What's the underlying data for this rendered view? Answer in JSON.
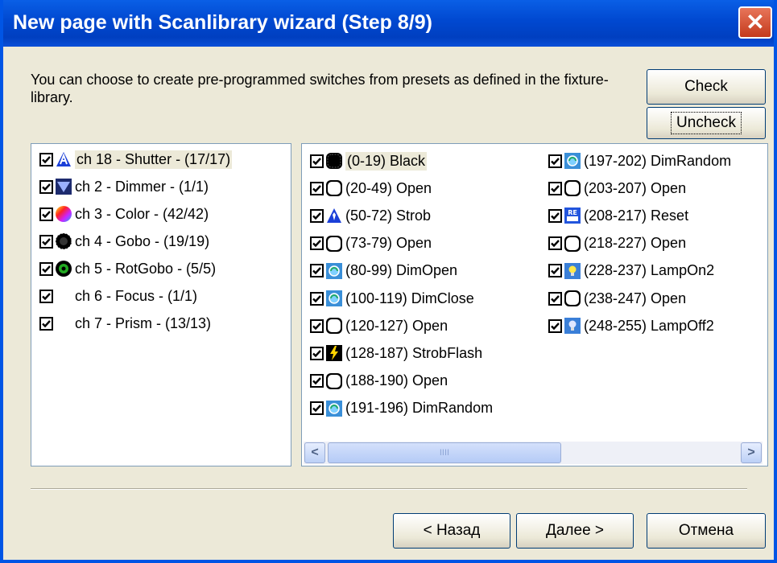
{
  "window": {
    "title": "New page with Scanlibrary wizard (Step 8/9)",
    "close_glyph": "✕"
  },
  "description": "You can choose to create pre-programmed switches from presets as defined in the fixture-library.",
  "buttons": {
    "check": "Check",
    "uncheck": "Uncheck",
    "back": "< Назад",
    "next": "Далее >",
    "cancel": "Отмена"
  },
  "channels": [
    {
      "label": "ch 18 - Shutter - (17/17)",
      "icon": "shutter-icon",
      "checked": true,
      "selected": true
    },
    {
      "label": "ch 2 - Dimmer - (1/1)",
      "icon": "dimmer-icon",
      "checked": true
    },
    {
      "label": "ch 3 - Color - (42/42)",
      "icon": "color-icon",
      "checked": true
    },
    {
      "label": "ch 4 - Gobo - (19/19)",
      "icon": "gobo-icon",
      "checked": true
    },
    {
      "label": "ch 5 - RotGobo - (5/5)",
      "icon": "rotgobo-icon",
      "checked": true
    },
    {
      "label": "ch 6 - Focus - (1/1)",
      "icon": "",
      "checked": true
    },
    {
      "label": "ch 7 - Prism - (13/13)",
      "icon": "",
      "checked": true
    }
  ],
  "presets_col1": [
    {
      "label": "(0-19) Black",
      "icon": "black-icon",
      "checked": true,
      "selected": true
    },
    {
      "label": "(20-49) Open",
      "icon": "open-icon",
      "checked": true
    },
    {
      "label": "(50-72) Strob",
      "icon": "strob-icon",
      "checked": true
    },
    {
      "label": "(73-79) Open",
      "icon": "open-icon",
      "checked": true
    },
    {
      "label": "(80-99) DimOpen",
      "icon": "dim-icon",
      "checked": true
    },
    {
      "label": "(100-119) DimClose",
      "icon": "dim-icon",
      "checked": true
    },
    {
      "label": "(120-127) Open",
      "icon": "open-icon",
      "checked": true
    },
    {
      "label": "(128-187) StrobFlash",
      "icon": "flash-icon",
      "checked": true
    },
    {
      "label": "(188-190) Open",
      "icon": "open-icon",
      "checked": true
    },
    {
      "label": "(191-196) DimRandom",
      "icon": "dim-icon",
      "checked": true
    }
  ],
  "presets_col2": [
    {
      "label": "(197-202) DimRandom",
      "icon": "dim-icon",
      "checked": true
    },
    {
      "label": "(203-207) Open",
      "icon": "open-icon",
      "checked": true
    },
    {
      "label": "(208-217) Reset",
      "icon": "reset-icon",
      "checked": true
    },
    {
      "label": "(218-227) Open",
      "icon": "open-icon",
      "checked": true
    },
    {
      "label": "(228-237) LampOn2",
      "icon": "lamp-on-icon",
      "checked": true
    },
    {
      "label": "(238-247) Open",
      "icon": "open-icon",
      "checked": true
    },
    {
      "label": "(248-255) LampOff2",
      "icon": "lamp-off-icon",
      "checked": true
    }
  ],
  "scroll": {
    "left_arrow": "<",
    "right_arrow": ">",
    "grip": "IIII"
  }
}
